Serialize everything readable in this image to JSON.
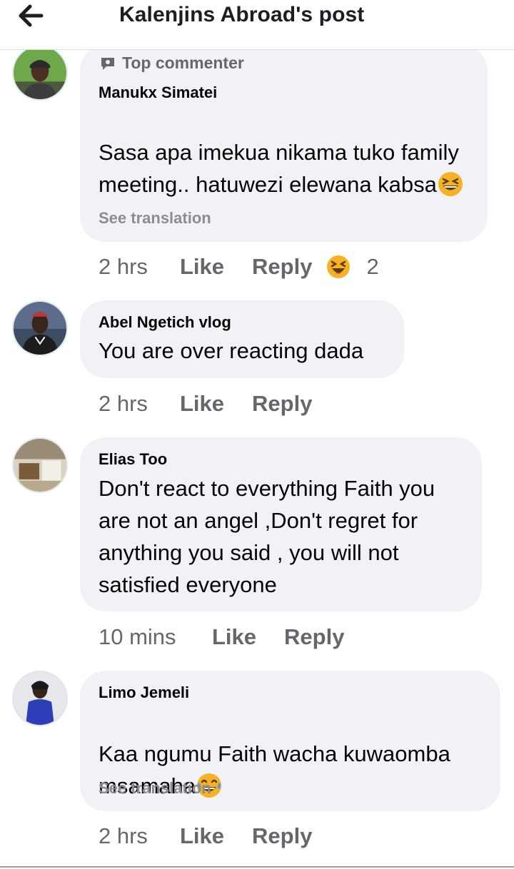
{
  "header": {
    "title": "Kalenjins Abroad's post",
    "back_icon": "arrow-left-icon"
  },
  "comments": [
    {
      "author": "Manukx Simatei",
      "badge": "Top commenter",
      "badge_icon": "speech-bubble-icon",
      "text": "Sasa apa imekua nikama tuko family meeting.. hatuwezi elewana kabsa",
      "emoji": "grinning-squinting-face-emoji",
      "see_translation": "See translation",
      "time": "2 hrs",
      "like": "Like",
      "reply": "Reply",
      "reaction_icon": "haha-reaction-icon",
      "reaction_count": "2"
    },
    {
      "author": "Abel Ngetich vlog",
      "text": "You are over reacting dada",
      "time": "2 hrs",
      "like": "Like",
      "reply": "Reply"
    },
    {
      "author": "Elias Too",
      "text": "Don't react to everything Faith you\nare not an angel ,Don't regret for\nanything you said , you will not\nsatisfied everyone",
      "time": "10 mins",
      "like": "Like",
      "reply": "Reply"
    },
    {
      "author": "Limo Jemeli",
      "text": "Kaa ngumu Faith wacha kuwaomba\nmsamaha",
      "emoji": "face-with-tears-of-joy-emoji",
      "see_translation": "See translation",
      "time": "2 hrs",
      "like": "Like",
      "reply": "Reply"
    }
  ],
  "colors": {
    "bubble": "#f0f2f5",
    "meta_text": "#65676b",
    "translation_text": "#8a8d91",
    "haha_yellow": "#f7b125"
  }
}
